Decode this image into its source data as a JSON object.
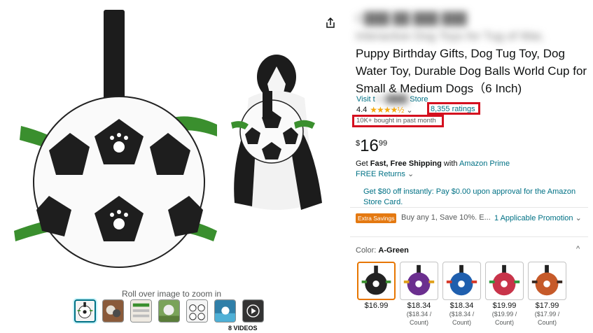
{
  "gallery": {
    "zoom_hint": "Roll over image to zoom in",
    "videos_label": "8 VIDEOS",
    "thumbnail_count": 6
  },
  "product": {
    "title_blurred": "C███ ██ ███ ███",
    "title_line2_blurred": "Interactive Dog Toys for Tug of War,",
    "title_rest": "Puppy Birthday Gifts, Dog Tug Toy, Dog Water Toy, Durable Dog Balls World Cup for Small & Medium Dogs（6 Inch)",
    "store_prefix": "Visit t",
    "store_name_blurred": "he ████",
    "store_suffix": " Store",
    "rating_value": "4.4",
    "stars": "★★★★½",
    "rating_chevron": "⌄",
    "ratings_count": "8,355 ratings",
    "bought": "10K+ bought in past month"
  },
  "price": {
    "symbol": "$",
    "whole": "16",
    "fraction": "99"
  },
  "shipping": {
    "prefix": "Get ",
    "bold": "Fast, Free Shipping",
    "middle": " with ",
    "prime": "Amazon Prime",
    "free_returns": "FREE Returns",
    "returns_chevron": "⌄"
  },
  "offer": {
    "card_text": "Get $80 off instantly: Pay $0.00 upon approval for the Amazon Store Card."
  },
  "promo": {
    "badge": "Extra Savings",
    "text": "Buy any 1, Save 10%. E...",
    "applicable": "1 Applicable Promotion",
    "chevron": "⌄"
  },
  "color": {
    "label": "Color:",
    "selected": "A-Green",
    "collapse": "^",
    "options": [
      {
        "price": "$16.99",
        "unit": "",
        "ball": "#222222",
        "accent": "#3a8f2e"
      },
      {
        "price": "$18.34",
        "unit": "($18.34 / Count)",
        "ball": "#6b2f8f",
        "accent": "#e0a21d"
      },
      {
        "price": "$18.34",
        "unit": "($18.34 / Count)",
        "ball": "#1f5fae",
        "accent": "#d63a2a"
      },
      {
        "price": "$19.99",
        "unit": "($19.99 / Count)",
        "ball": "#c8344a",
        "accent": "#2f9a3e"
      },
      {
        "price": "$17.99",
        "unit": "($17.99 / Count)",
        "ball": "#c65a2a",
        "accent": "#3a2a22"
      }
    ]
  }
}
